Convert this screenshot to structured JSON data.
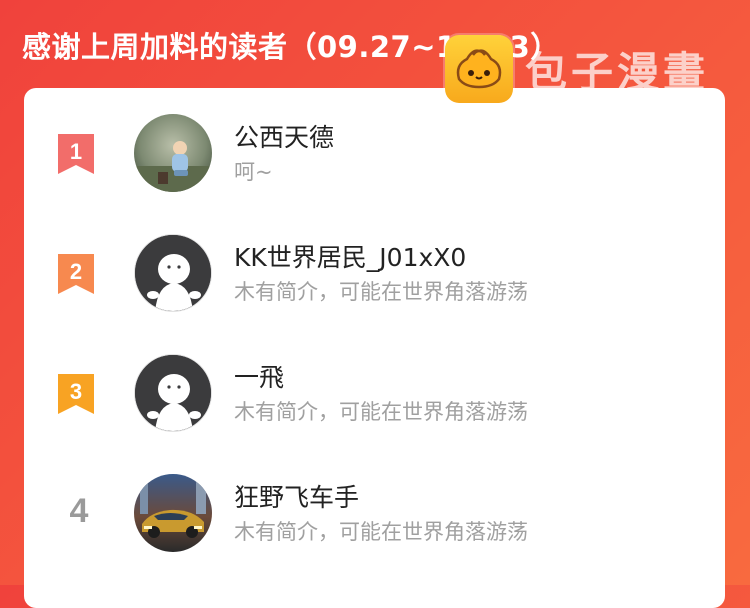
{
  "header": {
    "title": "感谢上周加料的读者（09.27~10.03）"
  },
  "watermark": {
    "text": "包子漫畫",
    "logo_icon": "bun-mascot-icon"
  },
  "colors": {
    "background": "#f0423c",
    "rank1": "#f26d6a",
    "rank2": "#f7894f",
    "rank3": "#f8a323",
    "rank_plain": "#9a9a9a"
  },
  "readers": [
    {
      "rank": "1",
      "name": "公西天德",
      "bio": "呵~",
      "avatar": "photo-child-avatar"
    },
    {
      "rank": "2",
      "name": "KK世界居民_J01xX0",
      "bio": "木有简介，可能在世界角落游荡",
      "avatar": "default-avatar"
    },
    {
      "rank": "3",
      "name": "一飛",
      "bio": "木有简介，可能在世界角落游荡",
      "avatar": "default-avatar"
    },
    {
      "rank": "4",
      "name": "狂野飞车手",
      "bio": "木有简介，可能在世界角落游荡",
      "avatar": "car-photo-avatar"
    }
  ]
}
